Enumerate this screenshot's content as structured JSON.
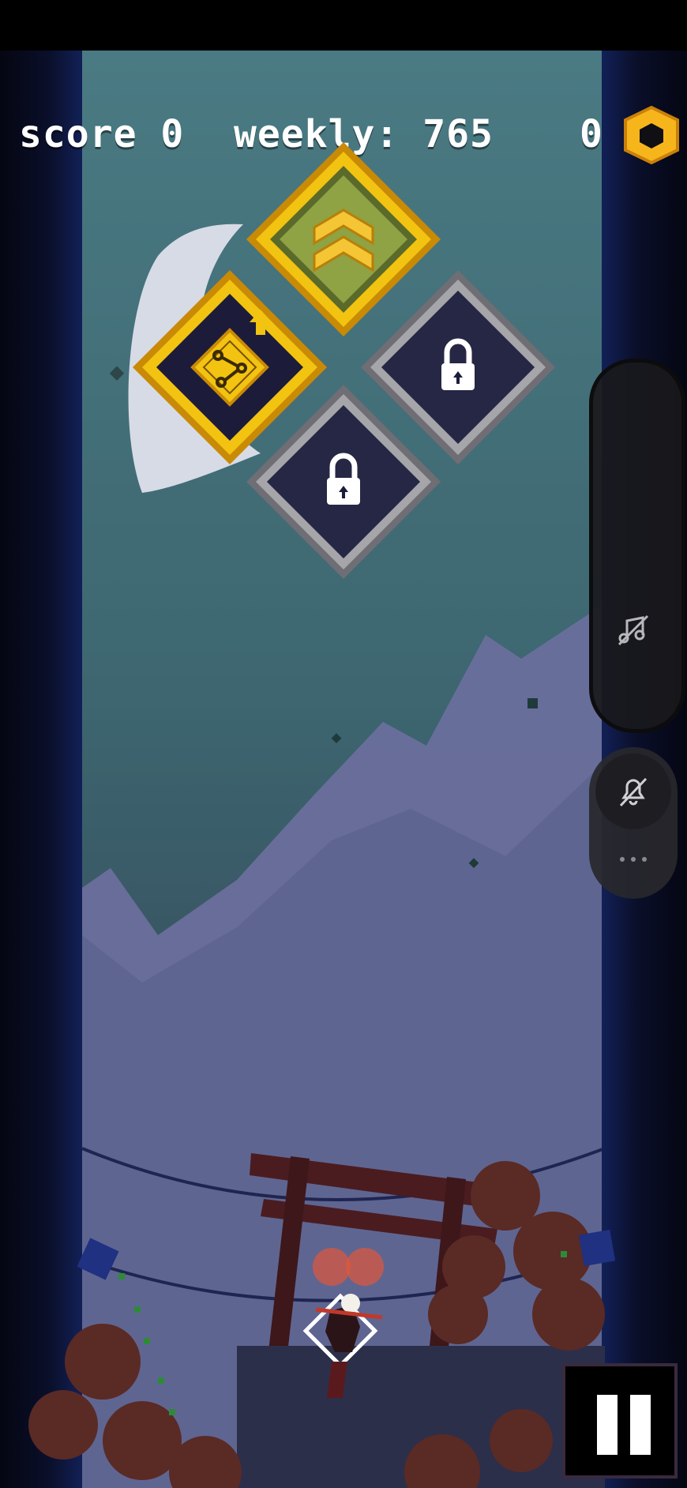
{
  "hud": {
    "score_label": "score",
    "score_value": "0",
    "weekly_label": "weekly:",
    "weekly_value": "765",
    "coins_value": "0"
  },
  "powerups": [
    {
      "name": "rank-up",
      "state": "unlocked"
    },
    {
      "name": "branch-path",
      "state": "upgradable"
    },
    {
      "name": "slot-3",
      "state": "locked"
    },
    {
      "name": "slot-4",
      "state": "locked"
    }
  ],
  "side_panel": {
    "music_icon": "music-off-icon",
    "sound_icon": "bell-off-icon",
    "more_icon": "more-dots-icon"
  },
  "controls": {
    "pause_icon": "pause-icon"
  },
  "colors": {
    "gold": "#f2c311",
    "gold_dark": "#c98a06",
    "locked_border": "#9a9a9e",
    "sky": "#4a7a83",
    "mountain": "#6a6f9c"
  }
}
